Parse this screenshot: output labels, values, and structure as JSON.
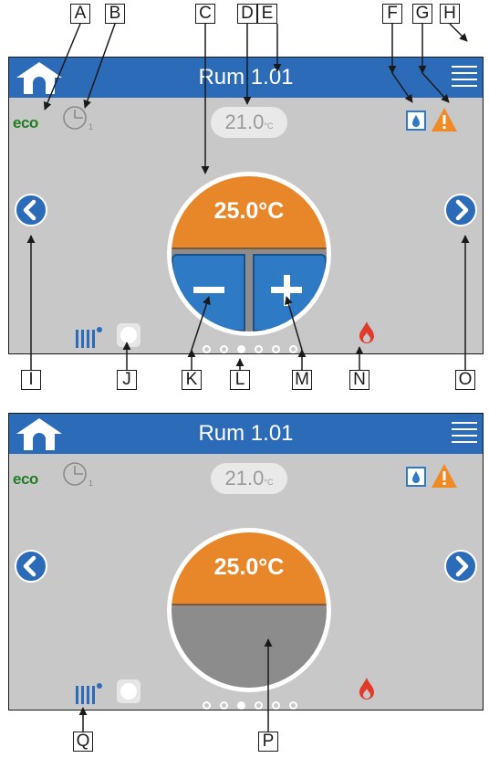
{
  "title": "Rum 1.01",
  "eco_label": "eco",
  "clock_subscript": "1",
  "current_temp": "21.0",
  "current_temp_unit": "°C",
  "set_temp": "25.0°C",
  "page_dots": {
    "count": 6,
    "active_index": 2
  },
  "callouts_top": [
    "A",
    "B",
    "C",
    "D",
    "E",
    "F",
    "G",
    "H"
  ],
  "callouts_bottom": [
    "I",
    "J",
    "K",
    "L",
    "M",
    "N",
    "O"
  ],
  "callouts_lower": [
    "Q",
    "P"
  ],
  "colors": {
    "bar": "#2c6bb8",
    "dial_top": "#e8872a",
    "button": "#2e7ac4",
    "eco": "#1f7f22",
    "flame": "#e03a2a",
    "warning": "#f08a24"
  },
  "icons": [
    "home-icon",
    "menu-icon",
    "clock-icon",
    "water-drop-icon",
    "warning-icon",
    "chevron-left-icon",
    "chevron-right-icon",
    "radiator-icon",
    "flame-icon"
  ]
}
